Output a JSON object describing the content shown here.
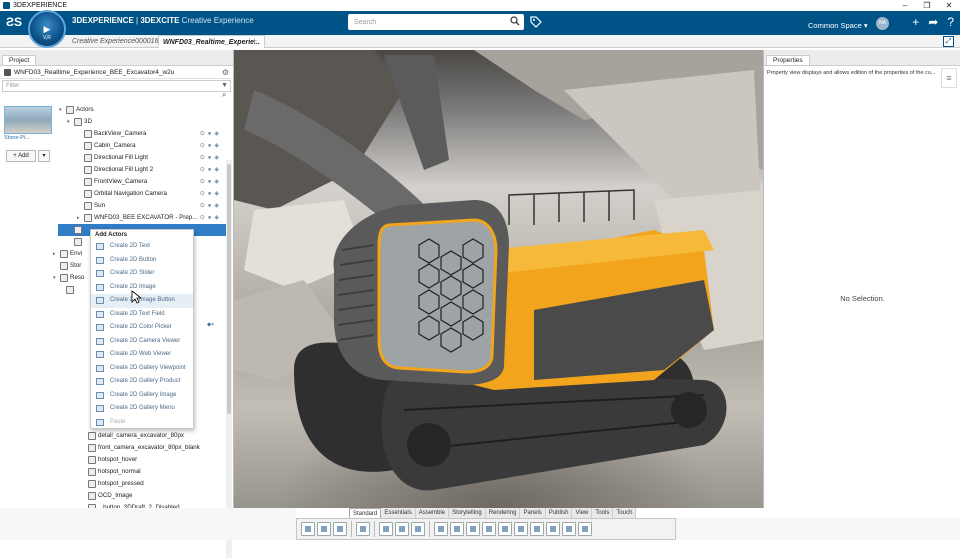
{
  "window": {
    "title": "3DEXPERIENCE",
    "controls": [
      "–",
      "❐",
      "✕"
    ]
  },
  "topbar": {
    "brand": "3DEXPERIENCE",
    "separator": " | ",
    "app": "3DEXCITE",
    "app_sub": " Creative Experience",
    "compass_version": "V,R",
    "search_placeholder": "Search",
    "space_label": "Common Space ▾",
    "avatar_text": "NA",
    "icons": [
      "plus-icon",
      "share-icon",
      "help-icon"
    ]
  },
  "tabs": [
    {
      "label": "Creative Experience000016",
      "active": false
    },
    {
      "label": "WNFD03_Realtime_Experie...",
      "active": true
    }
  ],
  "tab_add": "+",
  "project": {
    "tab_label": "Project",
    "name": "WNFD03_Realtime_Experience_BEE_Excavator4_w2u",
    "filter_placeholder": "Filter",
    "thumb_label": "Stone-Pi...",
    "add_label": "+ Add",
    "add_drop": "▾",
    "tree": [
      {
        "label": "Actors",
        "indent": 1,
        "arrow": "▾"
      },
      {
        "label": "3D",
        "indent": 2,
        "arrow": "▾"
      },
      {
        "label": "BackView_Camera",
        "indent": 3,
        "acts": true
      },
      {
        "label": "Cabin_Camera",
        "indent": 3,
        "acts": true
      },
      {
        "label": "Directional Fill Light",
        "indent": 3,
        "acts": true
      },
      {
        "label": "Directional Fill Light 2",
        "indent": 3,
        "acts": true
      },
      {
        "label": "FrontView_Camera",
        "indent": 3,
        "acts": true
      },
      {
        "label": "Orbital Navigation Camera",
        "indent": 3,
        "acts": true
      },
      {
        "label": "Sun",
        "indent": 3,
        "acts": true
      },
      {
        "label": "WNFD03_BEE EXCAVATOR - Prep...",
        "indent": 3,
        "acts": true,
        "arrow": "▸"
      },
      {
        "label": "",
        "indent": 2,
        "selected": true
      },
      {
        "label": "",
        "indent": 2
      },
      {
        "label": "Envi",
        "indent": 0,
        "arrow": "▸"
      },
      {
        "label": "Stor",
        "indent": 0
      },
      {
        "label": "Reso",
        "indent": 0,
        "arrow": "▾"
      },
      {
        "label": "",
        "indent": 1
      }
    ],
    "lower_items": [
      "detail_camera_excavator_80px",
      "front_camera_excavator_80px_blank",
      "hotspot_hover",
      "hotspot_normal",
      "hotspot_pressed",
      "OCD_Image",
      "...button_3DDraft_2_Disabled"
    ]
  },
  "context_menu": {
    "title": "Add Actors",
    "items": [
      {
        "label": "Create 2D Text",
        "icon": "text-icon"
      },
      {
        "label": "Create 2D Button",
        "icon": "button-icon"
      },
      {
        "label": "Create 2D Slider",
        "icon": "slider-icon"
      },
      {
        "label": "Create 2D Image",
        "icon": "image-icon"
      },
      {
        "label": "Create 2D Image Button",
        "icon": "image-button-icon",
        "highlight": true
      },
      {
        "label": "Create 2D Text Field",
        "icon": "text-field-icon"
      },
      {
        "label": "Create 2D Color Picker",
        "icon": "color-picker-icon"
      },
      {
        "label": "Create 2D Camera Viewer",
        "icon": "camera-viewer-icon"
      },
      {
        "label": "Create 2D Web Viewer",
        "icon": "web-viewer-icon"
      },
      {
        "label": "Create 2D Gallery Viewpoint",
        "icon": "gallery-viewpoint-icon"
      },
      {
        "label": "Create 2D Gallery Product",
        "icon": "gallery-product-icon"
      },
      {
        "label": "Create 2D Gallery Image",
        "icon": "gallery-image-icon"
      },
      {
        "label": "Create 2D Gallery Menu",
        "icon": "gallery-menu-icon"
      },
      {
        "label": "Paste",
        "icon": "paste-icon",
        "disabled": true
      }
    ]
  },
  "properties": {
    "tab_label": "Properties",
    "description": "Property view displays and allows edition of the properties of the cu...",
    "empty": "No Selection."
  },
  "bottom_tabs": [
    "Standard",
    "Essentials",
    "Assemble",
    "Storytelling",
    "Rendering",
    "Panels",
    "Publish",
    "View",
    "Tools",
    "Touch"
  ],
  "bottom_active": "Standard",
  "colors": {
    "topbar": "#005386",
    "selection": "#2e7dc5",
    "excavator_yellow": "#f2a51c"
  }
}
